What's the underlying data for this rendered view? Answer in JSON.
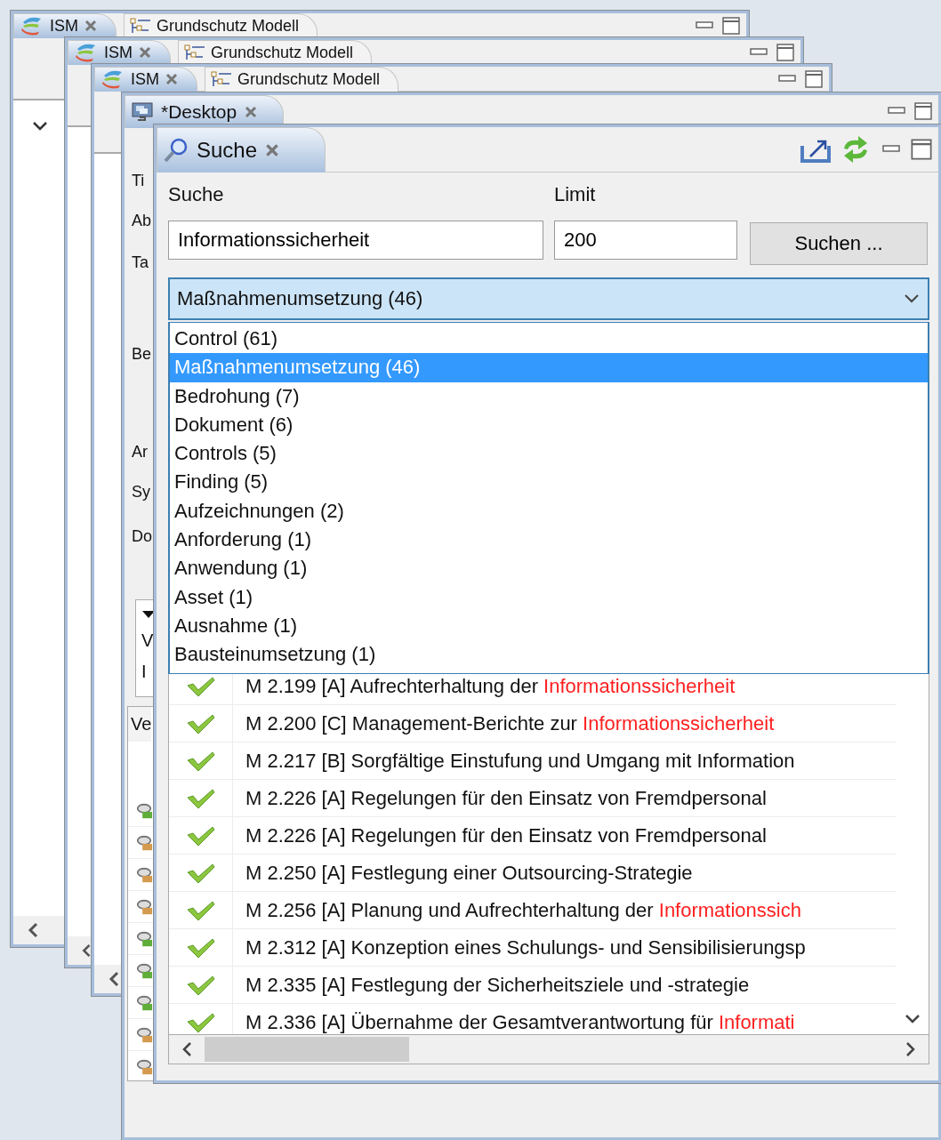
{
  "background_windows": [
    {
      "tabs": [
        {
          "label": "ISM",
          "selected": true
        },
        {
          "label": "Grundschutz Modell",
          "selected": false
        }
      ]
    },
    {
      "tabs": [
        {
          "label": "ISM",
          "selected": true
        },
        {
          "label": "Grundschutz Modell",
          "selected": false
        }
      ]
    },
    {
      "tabs": [
        {
          "label": "ISM",
          "selected": true
        },
        {
          "label": "Grundschutz Modell",
          "selected": false
        }
      ]
    }
  ],
  "desktop_window": {
    "tab": {
      "label": "*Desktop",
      "selected": true
    },
    "field_labels": [
      "Ti",
      "Ab",
      "Ta",
      "Be",
      "Ar",
      "Sy",
      "Do"
    ],
    "tree_items": [
      "V",
      "I"
    ],
    "table_header": "Ve",
    "rows": [
      {
        "color": "#5fae3a"
      },
      {
        "color": "#d49a4e"
      },
      {
        "color": "#d49a4e"
      },
      {
        "color": "#d49a4e"
      },
      {
        "color": "#5fae3a"
      },
      {
        "color": "#5fae3a"
      },
      {
        "color": "#5fae3a"
      },
      {
        "color": "#d49a4e"
      },
      {
        "color": "#d49a4e"
      }
    ]
  },
  "search_window": {
    "tab": {
      "label": "Suche",
      "selected": true
    },
    "search_label": "Suche",
    "search_value": "Informationssicherheit",
    "limit_label": "Limit",
    "limit_value": "200",
    "search_button": "Suchen ...",
    "type_combo": {
      "value": "Maßnahmenumsetzung (46)",
      "expanded": true,
      "options": [
        {
          "label": "Control (61)",
          "selected": false
        },
        {
          "label": "Maßnahmenumsetzung (46)",
          "selected": true
        },
        {
          "label": "Bedrohung (7)",
          "selected": false
        },
        {
          "label": "Dokument (6)",
          "selected": false
        },
        {
          "label": "Controls (5)",
          "selected": false
        },
        {
          "label": "Finding (5)",
          "selected": false
        },
        {
          "label": "Aufzeichnungen (2)",
          "selected": false
        },
        {
          "label": "Anforderung (1)",
          "selected": false
        },
        {
          "label": "Anwendung (1)",
          "selected": false
        },
        {
          "label": "Asset (1)",
          "selected": false
        },
        {
          "label": "Ausnahme (1)",
          "selected": false
        },
        {
          "label": "Bausteinumsetzung (1)",
          "selected": false
        }
      ]
    },
    "results": [
      {
        "text": "M 2.199 [A] Aufrechterhaltung der ",
        "match": "Informationssicherheit"
      },
      {
        "text": "M 2.200 [C] Management-Berichte zur ",
        "match": "Informationssicherheit"
      },
      {
        "text": "M 2.217 [B] Sorgfältige Einstufung und Umgang mit Information"
      },
      {
        "text": "M 2.226 [A] Regelungen für den Einsatz von Fremdpersonal"
      },
      {
        "text": "M 2.226 [A] Regelungen für den Einsatz von Fremdpersonal"
      },
      {
        "text": "M 2.250 [A] Festlegung einer Outsourcing-Strategie"
      },
      {
        "text": "M 2.256 [A] Planung und Aufrechterhaltung der ",
        "match": "Informationssich"
      },
      {
        "text": "M 2.312 [A] Konzeption eines Schulungs- und Sensibilisierungsp"
      },
      {
        "text": "M 2.335 [A] Festlegung der Sicherheitsziele und -strategie"
      },
      {
        "text": "M 2.336 [A] Übernahme der Gesamtverantwortung für ",
        "match": "Informati"
      }
    ]
  }
}
